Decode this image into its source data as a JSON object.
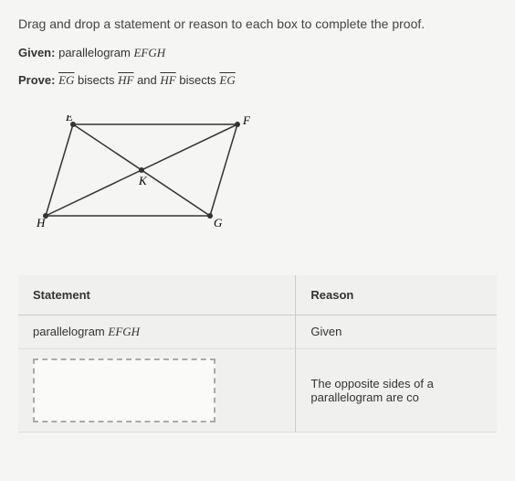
{
  "instruction": "Drag and drop a statement or reason to each box to complete the proof.",
  "given": {
    "label": "Given:",
    "text": "parallelogram ",
    "shape": "EFGH"
  },
  "prove": {
    "label": "Prove:",
    "seg1": "EG",
    "mid1": " bisects ",
    "seg2": "HF",
    "mid2": " and ",
    "seg3": "HF",
    "mid3": " bisects ",
    "seg4": "EG"
  },
  "diagram": {
    "points": {
      "E": "E",
      "F": "F",
      "G": "G",
      "H": "H",
      "K": "K"
    }
  },
  "table": {
    "headers": {
      "statement": "Statement",
      "reason": "Reason"
    },
    "rows": [
      {
        "statement_prefix": "parallelogram ",
        "statement_shape": "EFGH",
        "reason": "Given"
      },
      {
        "statement_prefix": "",
        "statement_shape": "",
        "reason": "The opposite sides of a parallelogram are co"
      }
    ]
  }
}
